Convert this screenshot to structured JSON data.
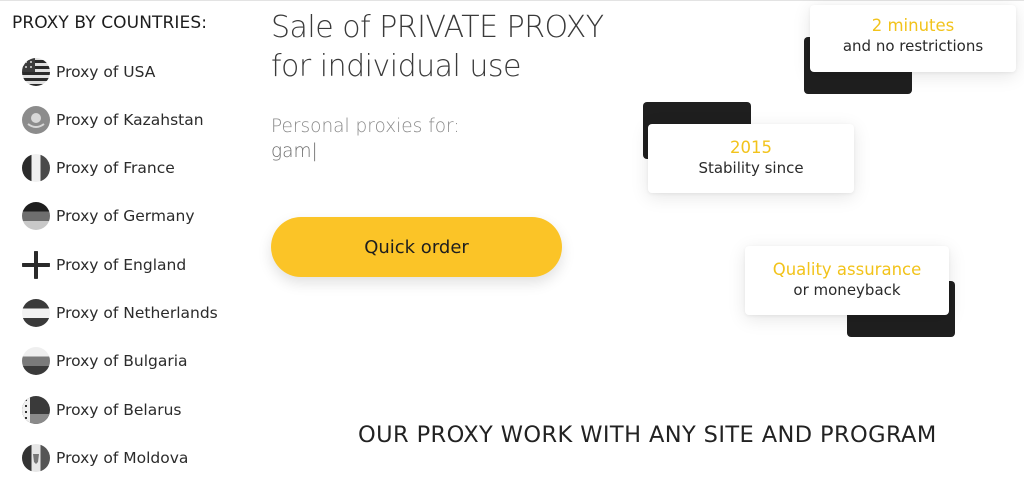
{
  "sidebar": {
    "title": "PROXY BY COUNTRIES:",
    "items": [
      {
        "label": "Proxy of USA",
        "icon": "usa-flag-icon"
      },
      {
        "label": "Proxy of Kazahstan",
        "icon": "kazakhstan-flag-icon"
      },
      {
        "label": "Proxy of France",
        "icon": "france-flag-icon"
      },
      {
        "label": "Proxy of Germany",
        "icon": "germany-flag-icon"
      },
      {
        "label": "Proxy of England",
        "icon": "england-flag-icon"
      },
      {
        "label": "Proxy of Netherlands",
        "icon": "netherlands-flag-icon"
      },
      {
        "label": "Proxy of Bulgaria",
        "icon": "bulgaria-flag-icon"
      },
      {
        "label": "Proxy of Belarus",
        "icon": "belarus-flag-icon"
      },
      {
        "label": "Proxy of Moldova",
        "icon": "moldova-flag-icon"
      }
    ]
  },
  "hero": {
    "title_line1": "Sale of PRIVATE PROXY",
    "title_line2": "for individual use",
    "subtitle": "Personal proxies for:",
    "typed_text": "gam|"
  },
  "quick_order": {
    "label": "Quick order"
  },
  "features": [
    {
      "highlight": "2 minutes",
      "text": "and no restrictions"
    },
    {
      "highlight": "2015",
      "text": "Stability since"
    },
    {
      "highlight": "Quality assurance",
      "text": "or moneyback"
    }
  ],
  "bottom_heading": "OUR PROXY WORK WITH ANY SITE AND PROGRAM",
  "colors": {
    "accent": "#fbc427",
    "highlight_text": "#f2c31b",
    "dark_block": "#1f1f1f"
  }
}
